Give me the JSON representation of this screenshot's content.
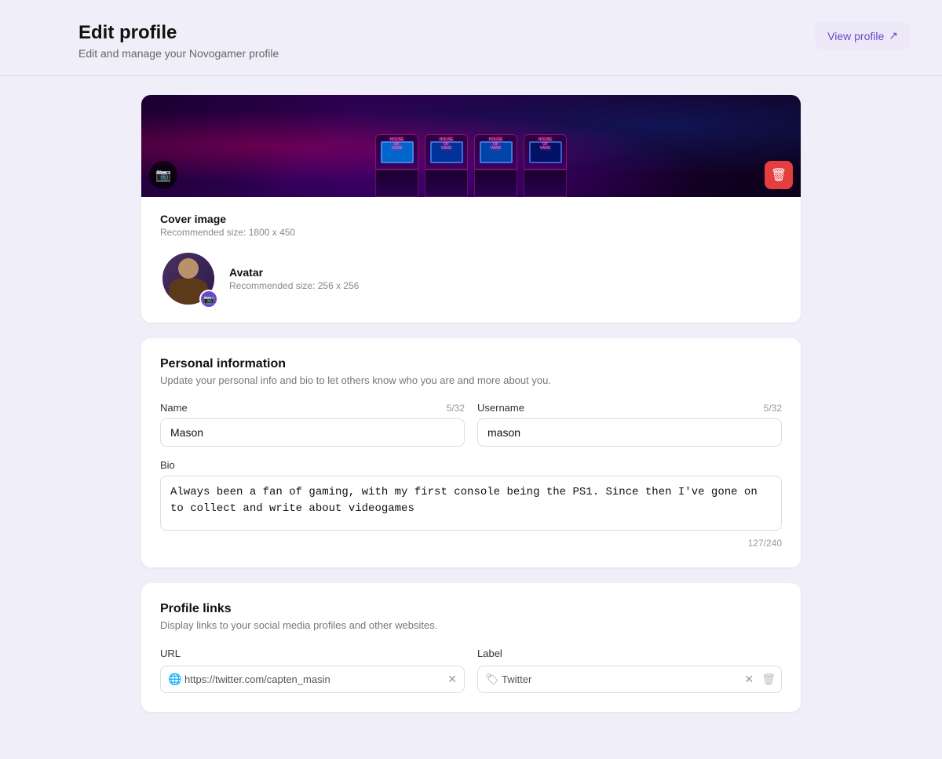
{
  "page": {
    "title": "Edit profile",
    "subtitle": "Edit and manage your Novogamer profile",
    "view_profile_btn": "View profile"
  },
  "cover": {
    "camera_icon": "📷",
    "delete_icon": "🗑",
    "label": "Cover image",
    "recommended": "Recommended size: 1800 x 450"
  },
  "avatar": {
    "camera_icon": "📷",
    "label": "Avatar",
    "recommended": "Recommended size: 256 x 256"
  },
  "personal_info": {
    "title": "Personal information",
    "desc": "Update your personal info and bio to let others know who you are and more about you.",
    "name_label": "Name",
    "name_value": "Mason",
    "name_counter": "5/32",
    "username_label": "Username",
    "username_value": "mason",
    "username_counter": "5/32",
    "bio_label": "Bio",
    "bio_value": "Always been a fan of gaming, with my first console being the PS1. Since then I've gone on to collect and write about videogames",
    "bio_counter": "127/240"
  },
  "profile_links": {
    "title": "Profile links",
    "desc": "Display links to your social media profiles and other websites.",
    "url_label": "URL",
    "label_label": "Label",
    "url_value": "https://twitter.com/capten_masin",
    "label_value": "Twitter",
    "url_icon": "🌐",
    "label_icon": "🏷"
  }
}
